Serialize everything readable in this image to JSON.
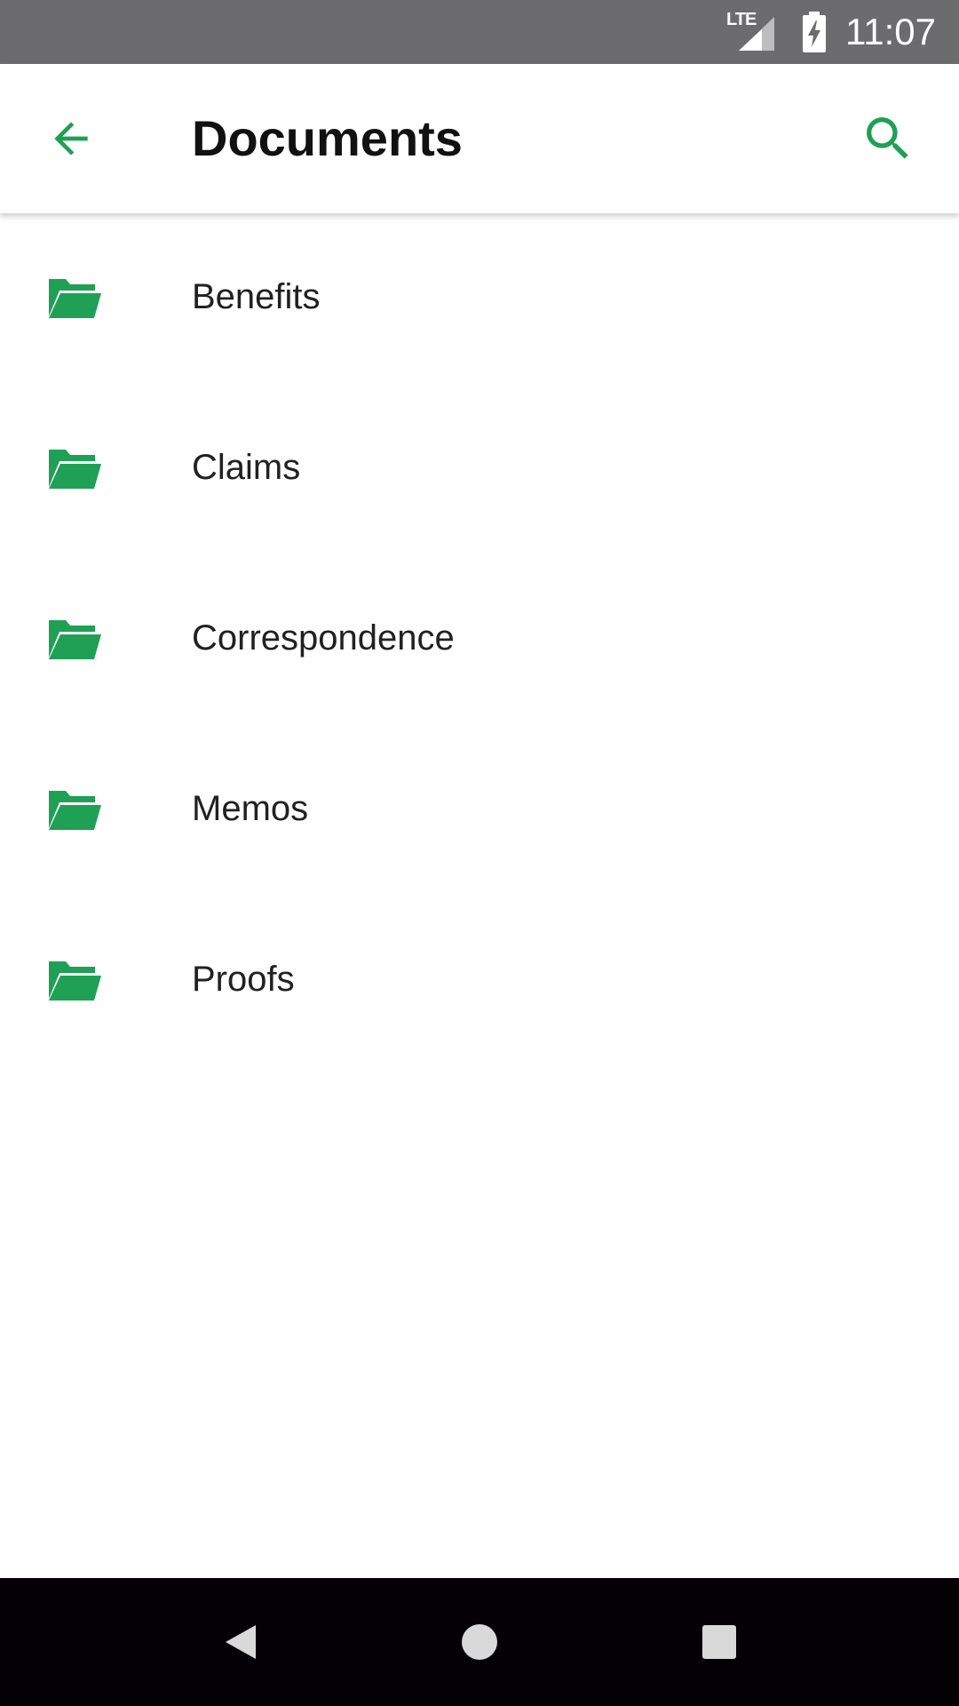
{
  "status_bar": {
    "network_label": "LTE",
    "time": "11:07",
    "signal_icon": "signal-icon",
    "battery_icon": "battery-charging-icon"
  },
  "app_bar": {
    "title": "Documents",
    "back_icon": "arrow-back-icon",
    "search_icon": "search-icon"
  },
  "folders": [
    {
      "label": "Benefits",
      "icon": "folder-open-icon"
    },
    {
      "label": "Claims",
      "icon": "folder-open-icon"
    },
    {
      "label": "Correspondence",
      "icon": "folder-open-icon"
    },
    {
      "label": "Memos",
      "icon": "folder-open-icon"
    },
    {
      "label": "Proofs",
      "icon": "folder-open-icon"
    }
  ],
  "nav_bar": {
    "back_icon": "nav-back-icon",
    "home_icon": "nav-home-icon",
    "recents_icon": "nav-recents-icon"
  },
  "colors": {
    "accent": "#1fa055",
    "status_bar": "#6c6b6e",
    "nav_bar": "#030104",
    "text": "#212121"
  }
}
